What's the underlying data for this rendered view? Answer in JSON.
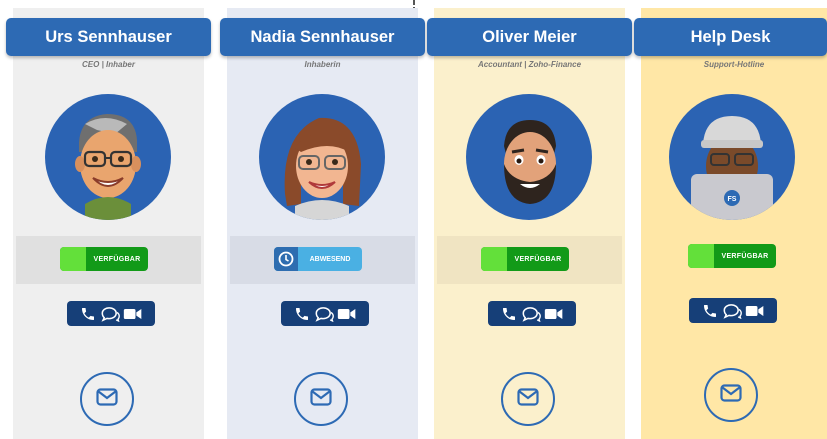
{
  "cards": [
    {
      "name": "Urs Sennhauser",
      "role": "CEO | Inhaber",
      "status": "VERFÜGBAR",
      "status_type": "available",
      "bg": "#efefef",
      "band_bg": "#e0e0e0"
    },
    {
      "name": "Nadia Sennhauser",
      "role": "Inhaberin",
      "status": "ABWESEND",
      "status_type": "absent",
      "bg": "#e6eaf3",
      "band_bg": "#d8dce6"
    },
    {
      "name": "Oliver Meier",
      "role": "Accountant | Zoho-Finance",
      "status": "VERFÜGBAR",
      "status_type": "available",
      "bg": "#fbf0cc",
      "band_bg": "#f0e4c2"
    },
    {
      "name": "Help Desk",
      "role": "Support-Hotline",
      "status": "VERFÜGBAR",
      "status_type": "available",
      "bg": "#ffe7a6",
      "band_bg": "#ffe7a6",
      "avatar_badge": "FS"
    }
  ],
  "icons": {
    "phone": "phone-icon",
    "chat": "chat-icon",
    "video": "video-icon",
    "mail": "mail-icon",
    "clock": "clock-icon"
  }
}
